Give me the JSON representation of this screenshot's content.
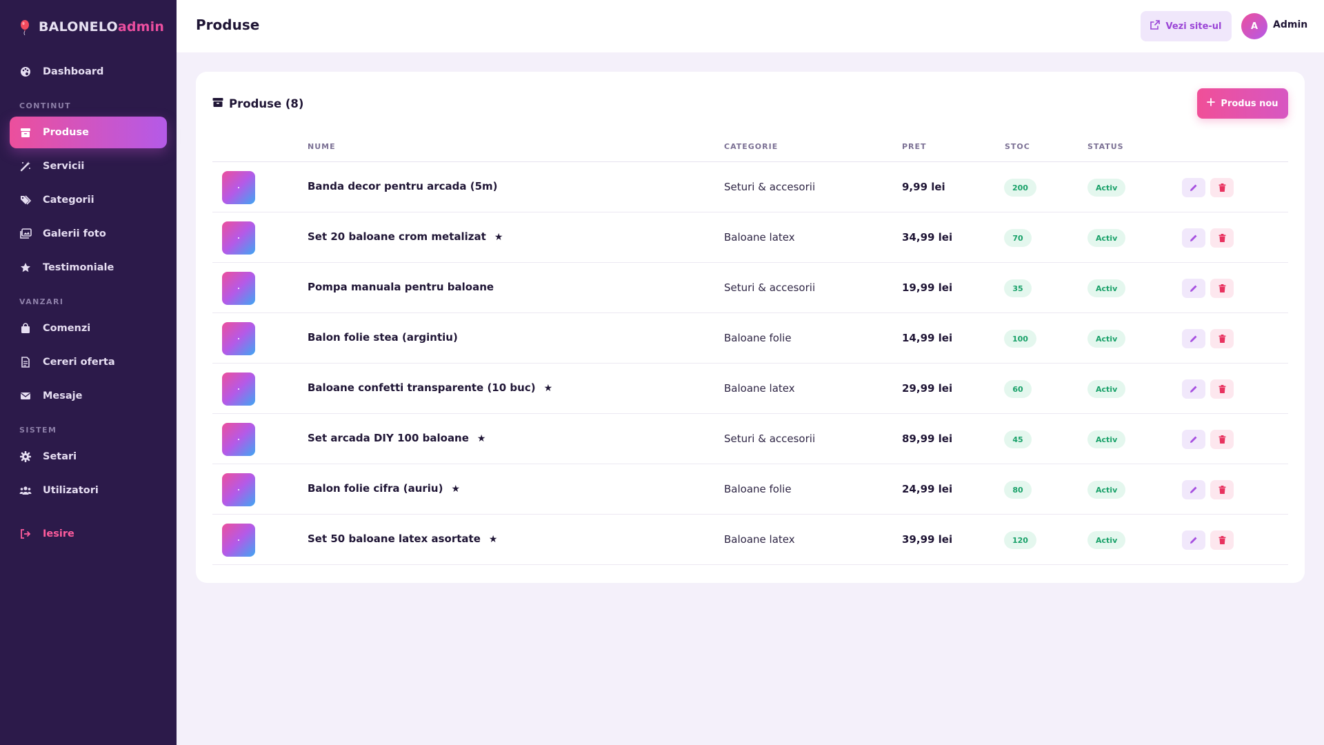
{
  "brand": {
    "name": "BALONELO",
    "suffix": "admin"
  },
  "sidebar": {
    "items": [
      {
        "label": "Dashboard",
        "icon": "palette-icon"
      },
      {
        "label": "Produse",
        "icon": "box-icon",
        "active": true
      },
      {
        "label": "Servicii",
        "icon": "magic-wand-icon"
      },
      {
        "label": "Categorii",
        "icon": "tags-icon"
      },
      {
        "label": "Galerii foto",
        "icon": "images-icon"
      },
      {
        "label": "Testimoniale",
        "icon": "star-icon"
      },
      {
        "label": "Comenzi",
        "icon": "shopping-bag-icon"
      },
      {
        "label": "Cereri oferta",
        "icon": "document-icon"
      },
      {
        "label": "Mesaje",
        "icon": "envelope-icon"
      },
      {
        "label": "Setari",
        "icon": "gear-icon"
      },
      {
        "label": "Utilizatori",
        "icon": "users-icon"
      },
      {
        "label": "Iesire",
        "icon": "logout-icon"
      }
    ],
    "sections": [
      "CONTINUT",
      "VANZARI",
      "SISTEM"
    ]
  },
  "header": {
    "title": "Produse",
    "view_site_label": "Vezi site-ul",
    "user_initial": "A",
    "user_name": "Admin"
  },
  "card": {
    "title": "Produse (8)",
    "new_button_label": "Produs nou",
    "columns": [
      "NUME",
      "CATEGORIE",
      "PRET",
      "STOC",
      "STATUS"
    ]
  },
  "products": [
    {
      "name": "Banda decor pentru arcada (5m)",
      "category": "Seturi & accesorii",
      "price": "9,99 lei",
      "stock": "200",
      "status": "Activ",
      "featured": false
    },
    {
      "name": "Set 20 baloane crom metalizat",
      "category": "Baloane latex",
      "price": "34,99 lei",
      "stock": "70",
      "status": "Activ",
      "featured": true
    },
    {
      "name": "Pompa manuala pentru baloane",
      "category": "Seturi & accesorii",
      "price": "19,99 lei",
      "stock": "35",
      "status": "Activ",
      "featured": false
    },
    {
      "name": "Balon folie stea (argintiu)",
      "category": "Baloane folie",
      "price": "14,99 lei",
      "stock": "100",
      "status": "Activ",
      "featured": false
    },
    {
      "name": "Baloane confetti transparente (10 buc)",
      "category": "Baloane latex",
      "price": "29,99 lei",
      "stock": "60",
      "status": "Activ",
      "featured": true
    },
    {
      "name": "Set arcada DIY 100 baloane",
      "category": "Seturi & accesorii",
      "price": "89,99 lei",
      "stock": "45",
      "status": "Activ",
      "featured": true
    },
    {
      "name": "Balon folie cifra (auriu)",
      "category": "Baloane folie",
      "price": "24,99 lei",
      "stock": "80",
      "status": "Activ",
      "featured": true
    },
    {
      "name": "Set 50 baloane latex asortate",
      "category": "Baloane latex",
      "price": "39,99 lei",
      "stock": "120",
      "status": "Activ",
      "featured": true
    }
  ],
  "featured_glyph": "★",
  "colors": {
    "sidebar_bg": "#2c1a4a",
    "accent_pink": "#ec4f9c",
    "accent_purple": "#b45ae8",
    "status_green": "#19a169",
    "delete_red": "#e8325f"
  }
}
